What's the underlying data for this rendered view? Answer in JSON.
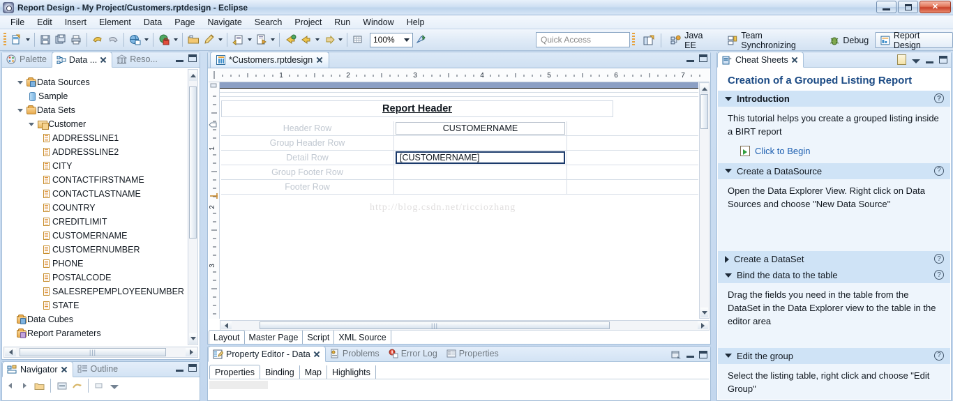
{
  "window": {
    "title": "Report Design - My Project/Customers.rptdesign - Eclipse",
    "minimize_label": "Minimize",
    "restore_label": "Restore",
    "close_label": "Close"
  },
  "menubar": {
    "items": [
      "File",
      "Edit",
      "Insert",
      "Element",
      "Data",
      "Page",
      "Navigate",
      "Search",
      "Project",
      "Run",
      "Window",
      "Help"
    ]
  },
  "toolbar": {
    "zoom_value": "100%",
    "quick_access_placeholder": "Quick Access",
    "buttons": [
      "new-icon",
      "save-icon",
      "save-all-icon",
      "print-icon",
      "undo-icon",
      "redo-icon",
      "preview-web-icon",
      "preview-secure-icon",
      "open-folder-icon",
      "edit-pencil-icon",
      "run-script-icon",
      "run-report-icon",
      "back-icon",
      "forward-icon",
      "next-icon",
      "grid-icon",
      "zoom-fit-icon"
    ],
    "perspectives": [
      {
        "label": "Java EE",
        "icon": "java-ee-icon",
        "active": false
      },
      {
        "label": "Team Synchronizing",
        "icon": "team-sync-icon",
        "active": false
      },
      {
        "label": "Debug",
        "icon": "debug-icon",
        "active": false
      },
      {
        "label": "Report Design",
        "icon": "report-design-icon",
        "active": true
      }
    ],
    "open_perspective_label": "Open Perspective"
  },
  "data_explorer": {
    "tabs": [
      {
        "label": "Palette",
        "icon": "palette-icon",
        "active": false
      },
      {
        "label": "Data ...",
        "icon": "data-explorer-icon",
        "active": true
      },
      {
        "label": "Reso...",
        "icon": "resource-icon",
        "active": false
      }
    ],
    "tree": [
      {
        "label": "Data Sources",
        "level": 0,
        "icon": "folder-icon",
        "twisty": "open"
      },
      {
        "label": "Sample",
        "level": 1,
        "icon": "datasource-icon",
        "twisty": "none"
      },
      {
        "label": "Data Sets",
        "level": 0,
        "icon": "folder-icon",
        "twisty": "open"
      },
      {
        "label": "Customer",
        "level": 1,
        "icon": "dataset-icon",
        "twisty": "open"
      },
      {
        "label": "ADDRESSLINE1",
        "level": 2,
        "icon": "column-icon",
        "twisty": "none"
      },
      {
        "label": "ADDRESSLINE2",
        "level": 2,
        "icon": "column-icon",
        "twisty": "none"
      },
      {
        "label": "CITY",
        "level": 2,
        "icon": "column-icon",
        "twisty": "none"
      },
      {
        "label": "CONTACTFIRSTNAME",
        "level": 2,
        "icon": "column-icon",
        "twisty": "none"
      },
      {
        "label": "CONTACTLASTNAME",
        "level": 2,
        "icon": "column-icon",
        "twisty": "none"
      },
      {
        "label": "COUNTRY",
        "level": 2,
        "icon": "column-icon",
        "twisty": "none"
      },
      {
        "label": "CREDITLIMIT",
        "level": 2,
        "icon": "column-icon",
        "twisty": "none"
      },
      {
        "label": "CUSTOMERNAME",
        "level": 2,
        "icon": "column-icon",
        "twisty": "none"
      },
      {
        "label": "CUSTOMERNUMBER",
        "level": 2,
        "icon": "column-icon",
        "twisty": "none"
      },
      {
        "label": "PHONE",
        "level": 2,
        "icon": "column-icon",
        "twisty": "none"
      },
      {
        "label": "POSTALCODE",
        "level": 2,
        "icon": "column-icon",
        "twisty": "none"
      },
      {
        "label": "SALESREPEMPLOYEENUMBER",
        "level": 2,
        "icon": "column-icon",
        "twisty": "none"
      },
      {
        "label": "STATE",
        "level": 2,
        "icon": "column-icon",
        "twisty": "none"
      },
      {
        "label": "Data Cubes",
        "level": 0,
        "icon": "cube-folder-icon",
        "twisty": "none"
      },
      {
        "label": "Report Parameters",
        "level": 0,
        "icon": "params-folder-icon",
        "twisty": "none"
      }
    ]
  },
  "navigator": {
    "tabs": [
      {
        "label": "Navigator",
        "icon": "navigator-icon",
        "active": true
      },
      {
        "label": "Outline",
        "icon": "outline-icon",
        "active": false
      }
    ]
  },
  "editor": {
    "tab_label": "*Customers.rptdesign",
    "tab_icon": "report-file-icon",
    "ruler_marks": [
      "1",
      "2",
      "3",
      "4",
      "5",
      "6",
      "7"
    ],
    "ruler_marks_v": [
      "1",
      "2",
      "3"
    ],
    "report_header": "Report Header",
    "table": {
      "rows": [
        {
          "label": "Header Row",
          "value": "CUSTOMERNAME",
          "boxed": true,
          "selected": false
        },
        {
          "label": "Group Header Row",
          "value": "",
          "boxed": false,
          "selected": false
        },
        {
          "label": "Detail Row",
          "value": "[CUSTOMERNAME]",
          "boxed": true,
          "selected": true
        },
        {
          "label": "Group Footer Row",
          "value": "",
          "boxed": false,
          "selected": false
        },
        {
          "label": "Footer Row",
          "value": "",
          "boxed": false,
          "selected": false
        }
      ]
    },
    "watermark": "http://blog.csdn.net/ricciozhang",
    "bottom_tabs": [
      {
        "label": "Layout",
        "active": true
      },
      {
        "label": "Master Page",
        "active": false
      },
      {
        "label": "Script",
        "active": false
      },
      {
        "label": "XML Source",
        "active": false
      }
    ]
  },
  "property_editor": {
    "tabs": [
      {
        "label": "Property Editor - Data",
        "icon": "property-editor-icon",
        "active": true
      },
      {
        "label": "Problems",
        "icon": "problems-icon",
        "active": false
      },
      {
        "label": "Error Log",
        "icon": "error-log-icon",
        "active": false
      },
      {
        "label": "Properties",
        "icon": "properties-icon",
        "active": false
      }
    ],
    "subtabs": [
      {
        "label": "Properties",
        "active": true
      },
      {
        "label": "Binding",
        "active": false
      },
      {
        "label": "Map",
        "active": false
      },
      {
        "label": "Highlights",
        "active": false
      }
    ]
  },
  "cheat_sheets": {
    "tab_label": "Cheat Sheets",
    "tab_icon": "cheat-sheets-icon",
    "title": "Creation of a Grouped Listing Report",
    "sections": [
      {
        "heading": "Introduction",
        "expanded": true,
        "bold": true,
        "body": "This tutorial helps you create a grouped listing inside a BIRT report",
        "action": "Click to Begin"
      },
      {
        "heading": "Create a DataSource",
        "expanded": true,
        "bold": false,
        "body": "Open the Data Explorer View. Right click on Data Sources and choose \"New Data Source\"",
        "action": ""
      },
      {
        "heading": "Create a DataSet",
        "expanded": false,
        "bold": false,
        "body": "",
        "action": ""
      },
      {
        "heading": "Bind the data to the table",
        "expanded": true,
        "bold": false,
        "body": "Drag the fields you need in the table from the DataSet in the Data Explorer view to the table in the editor area",
        "action": ""
      },
      {
        "heading": "Edit the group",
        "expanded": true,
        "bold": false,
        "body": "Select the listing table, right click and choose \"Edit Group\"",
        "action": ""
      }
    ],
    "help_glyph": "?"
  },
  "colors": {
    "accent": "#1b4a84",
    "selection": "#1b3a6b",
    "section_header_bg": "#cfe3f6",
    "section_body_bg": "#eef5fc",
    "chrome": "#cfe0f3"
  }
}
